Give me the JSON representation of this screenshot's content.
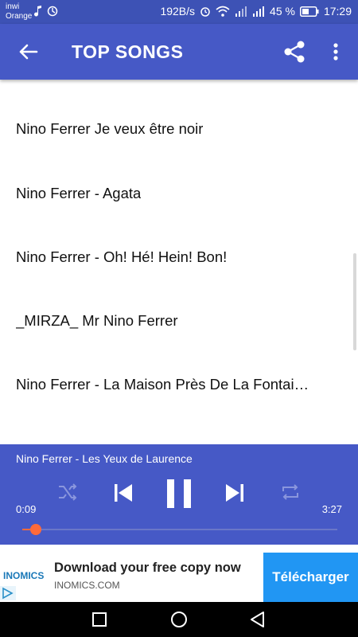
{
  "status_bar": {
    "carrier_line1": "inwi",
    "carrier_line2": "Orange",
    "net_speed": "192B/s",
    "battery_percent": "45 %",
    "time": "17:29"
  },
  "app_bar": {
    "title": "TOP SONGS"
  },
  "songs": [
    "Nino Ferrer  Je veux être noir",
    "Nino Ferrer - Agata",
    "Nino Ferrer - Oh! Hé! Hein! Bon!",
    "_MIRZA_  Mr Nino Ferrer",
    "Nino Ferrer - La Maison Près De La Fontaine"
  ],
  "player": {
    "now_playing": "Nino Ferrer - Les Yeux de Laurence",
    "elapsed": "0:09",
    "duration": "3:27",
    "progress": 0.043,
    "accent_color": "#ff6a3a"
  },
  "ad": {
    "brand": "INOMICS",
    "title": "Download your free copy now",
    "domain": "INOMICS.COM",
    "cta": "Télécharger"
  },
  "colors": {
    "primary": "#4659c6",
    "status_bar": "#3d52b5",
    "cta": "#2196f3"
  }
}
